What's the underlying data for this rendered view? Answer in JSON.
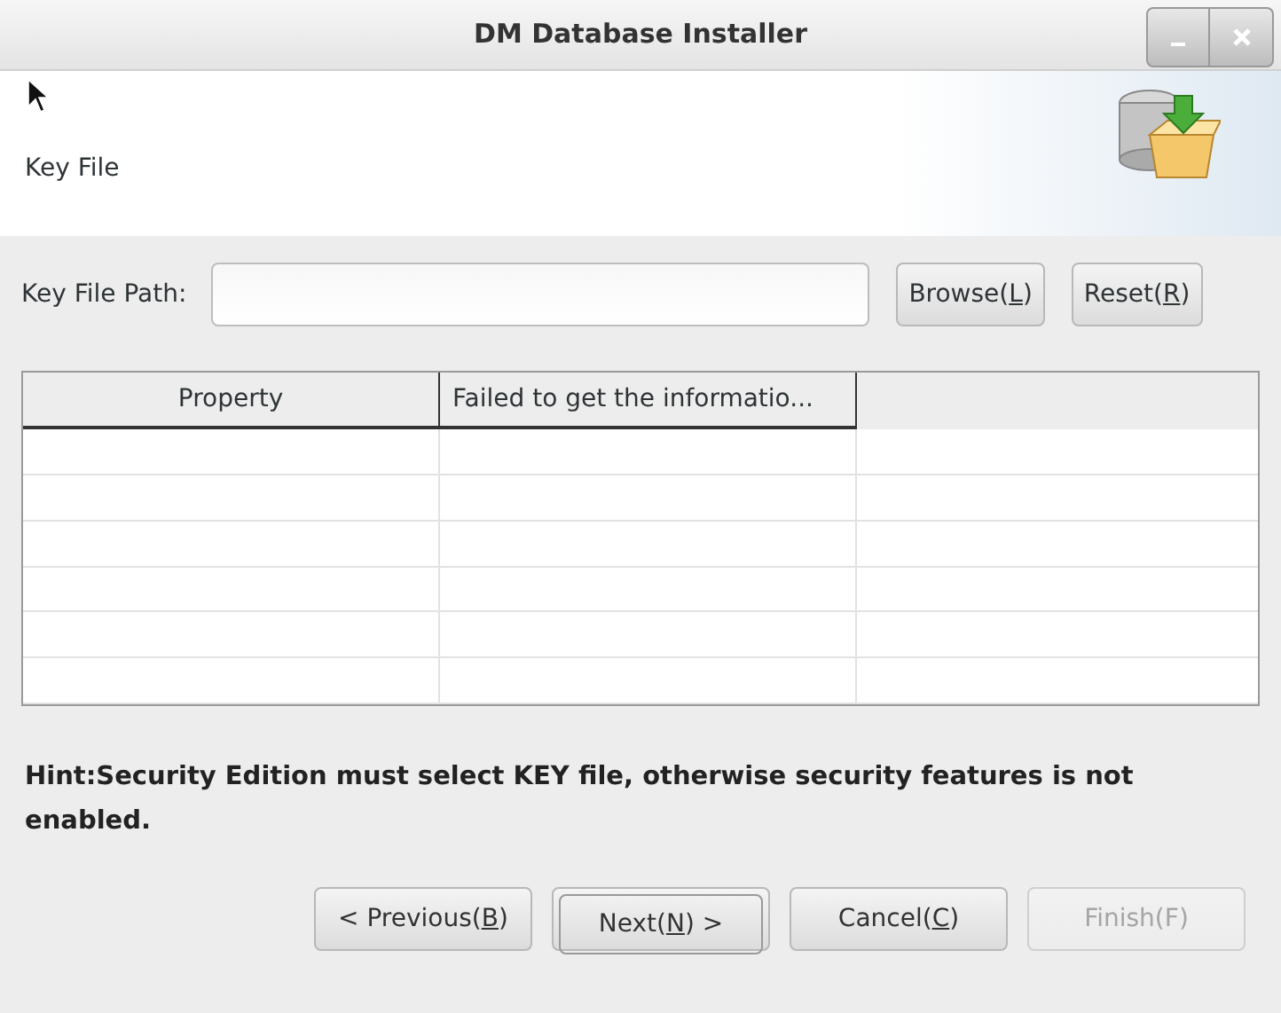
{
  "window": {
    "title": "DM Database Installer"
  },
  "header": {
    "title": "Key File"
  },
  "key_file": {
    "label": "Key File Path:",
    "buttons": [
      {
        "before": "Browse(",
        "key": "L",
        "after": ")"
      },
      {
        "before": "Reset(",
        "key": "R",
        "after": ")"
      }
    ]
  },
  "table": {
    "columns": [
      "Property",
      "Failed to get the informatio..."
    ]
  },
  "hint": "Hint:Security Edition must select KEY file, otherwise security features is not enabled.",
  "buttons": [
    {
      "before": "< Previous(",
      "key": "B",
      "after": ")",
      "focused": false,
      "disabled": false
    },
    {
      "before": "Next(",
      "key": "N",
      "after": ") >",
      "focused": true,
      "disabled": false
    },
    {
      "before": "Cancel(",
      "key": "C",
      "after": ")",
      "focused": false,
      "disabled": false
    },
    {
      "before": "Finish(F)",
      "focused": false,
      "disabled": true
    }
  ]
}
